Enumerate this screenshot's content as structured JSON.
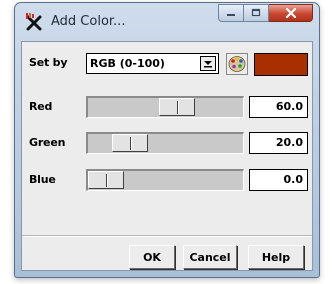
{
  "window": {
    "title": "Add Color...",
    "title_icon": "add-color-icon",
    "caption_buttons": [
      "minimize-icon",
      "maximize-icon",
      "close-icon"
    ]
  },
  "set_by": {
    "label": "Set by",
    "selected": "RGB (0-100)",
    "swatch_color": "#a83000",
    "palette_icon": "palette-icon"
  },
  "channels": [
    {
      "label": "Red",
      "value": "60.0",
      "level": 60
    },
    {
      "label": "Green",
      "value": "20.0",
      "level": 20
    },
    {
      "label": "Blue",
      "value": "0.0",
      "level": 0
    }
  ],
  "buttons": {
    "ok": "OK",
    "cancel": "Cancel",
    "help": "Help"
  }
}
